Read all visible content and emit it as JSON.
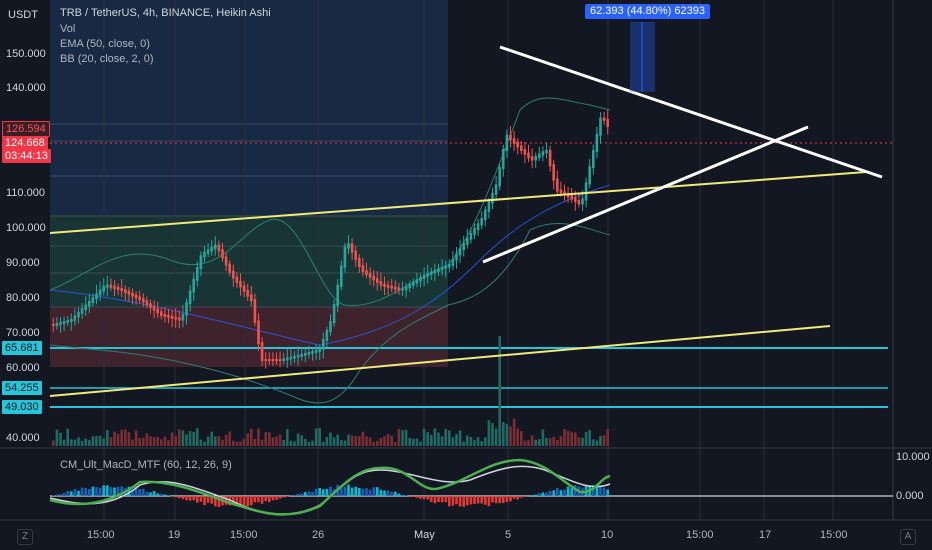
{
  "symbol_title": "TRB / TetherUS, 4h, BINANCE, Heikin Ashi",
  "indicators": {
    "vol": "Vol",
    "ema": "EMA (50, close, 0)",
    "bb": "BB (20, close, 2, 0)",
    "macd": "CM_Ult_MacD_MTF (60, 12, 26, 9)"
  },
  "currency": "USDT",
  "price_axis": [
    "150.000",
    "140.000",
    "110.000",
    "100.000",
    "90.000",
    "80.000",
    "70.000",
    "60.000",
    "40.000"
  ],
  "price_badges": {
    "p126": "126.594",
    "p124": "124.668",
    "countdown": "03:44:13",
    "p65": "65.681",
    "p54": "54.255",
    "p49": "49.030"
  },
  "measure_label": "62.393 (44.80%) 62393",
  "macd_axis": [
    "10.000",
    "0.000"
  ],
  "time_axis": [
    "15:00",
    "19",
    "15:00",
    "26",
    "May",
    "5",
    "10",
    "15:00",
    "17",
    "15:00"
  ],
  "corner_left": "Z",
  "corner_right": "A",
  "colors": {
    "background": "#131722",
    "bull": "#26a69a",
    "bear": "#ef5350",
    "white_line": "#ffffff",
    "yellow_line": "#f0ea7a",
    "cyan_line": "#26c6da",
    "measure": "#2962ff",
    "price_red": "#f23645"
  }
}
